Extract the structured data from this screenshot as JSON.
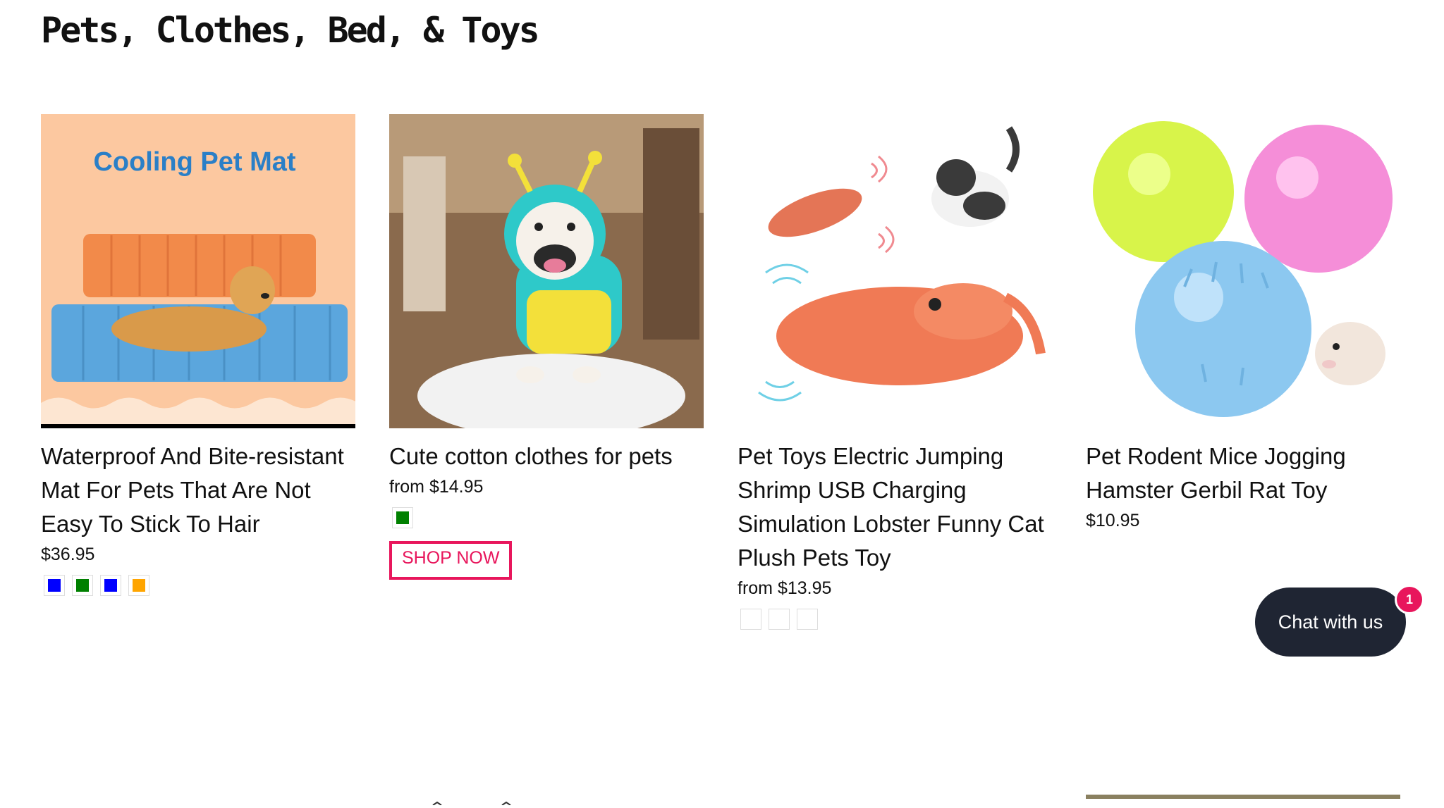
{
  "page": {
    "title": "Pets, Clothes, Bed, & Toys"
  },
  "products": [
    {
      "image_caption": "Cooling Pet Mat",
      "title": "Waterproof And Bite-resistant Mat For Pets That Are Not Easy To Stick To Hair",
      "price": "$36.95",
      "swatches": [
        "#0000ff",
        "#008000",
        "#0000ff",
        "#ffa500"
      ]
    },
    {
      "title": "Cute cotton clothes for pets",
      "price": "from $14.95",
      "swatches": [
        "#008000"
      ],
      "cta_label": "SHOP NOW"
    },
    {
      "title": "Pet Toys Electric Jumping Shrimp USB Charging Simulation Lobster Funny Cat Plush Pets Toy",
      "price": "from $13.95",
      "swatches": [
        "#ffffff",
        "#ffffff",
        "#ffffff"
      ]
    },
    {
      "title": "Pet Rodent Mice Jogging Hamster Gerbil Rat Toy",
      "price": "$10.95",
      "swatches": []
    }
  ],
  "chat": {
    "label": "Chat with us",
    "badge_count": "1"
  },
  "colors": {
    "accent": "#e8165c",
    "chat_bg": "#1f2533"
  }
}
